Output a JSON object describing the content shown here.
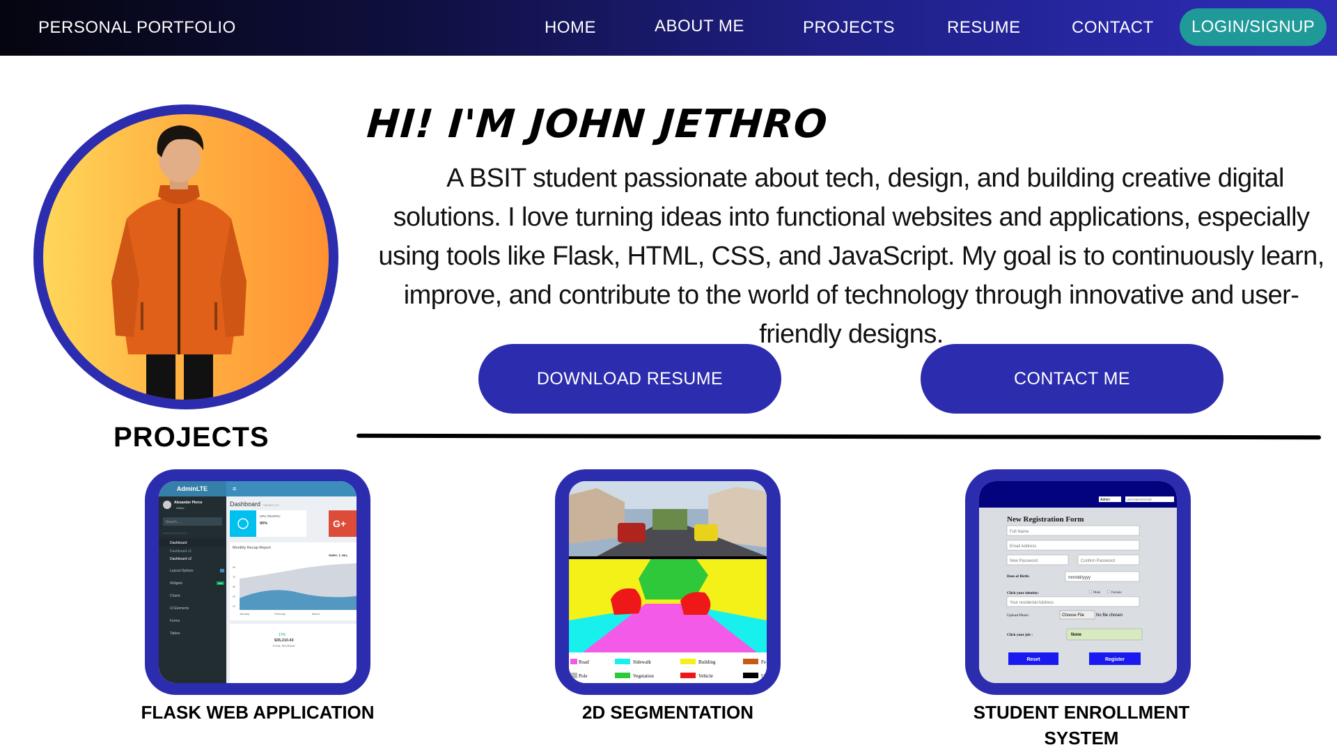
{
  "colors": {
    "accent": "#2c2cae",
    "login": "#1f9a99",
    "nav_start": "#05050f",
    "nav_end": "#2d2db8"
  },
  "navbar": {
    "brand": "PERSONAL PORTFOLIO",
    "links": [
      "HOME",
      "ABOUT ME",
      "PROJECTS",
      "RESUME",
      "CONTACT"
    ],
    "login": "LOGIN/SIGNUP"
  },
  "hero": {
    "title": "HI! I'M JOHN JETHRO",
    "description": "A BSIT student passionate about tech, design, and building creative digital solutions. I love turning ideas into functional websites and applications, especially using tools like Flask, HTML, CSS, and JavaScript. My goal is to continuously learn, improve, and contribute to the world of technology through innovative and user-friendly designs.",
    "buttons": {
      "resume": "DOWNLOAD RESUME",
      "contact": "CONTACT ME"
    }
  },
  "projects": {
    "heading": "PROJECTS",
    "items": [
      {
        "title": "FLASK WEB APPLICATION"
      },
      {
        "title": "2D SEGMENTATION"
      },
      {
        "title": "STUDENT ENROLLMENT SYSTEM"
      }
    ]
  },
  "thumb_admin": {
    "brand": "AdminLTE",
    "user": "Alexander Pierce",
    "status": "Online",
    "search": "Search...",
    "section": "MAIN NAVIGATION",
    "menu": [
      "Dashboard",
      "Dashboard v1",
      "Dashboard v2",
      "Layout Options",
      "Widgets",
      "Charts",
      "UI Elements",
      "Forms",
      "Tables"
    ],
    "page_title": "Dashboard",
    "version": "Version 2.0",
    "box_label": "CPU TRAFFIC",
    "box_value": "90%",
    "report_title": "Monthly Recap Report",
    "sales_label": "Sales: 1 Jan,",
    "months": [
      "January",
      "February",
      "March"
    ],
    "y_ticks": [
      "90",
      "80",
      "70",
      "60",
      "50",
      "40",
      "30",
      "20",
      "10"
    ],
    "stat_pct": "17%",
    "stat_value": "$35,210.43",
    "stat_label": "TOTAL REVENUE",
    "badge_new": "new"
  },
  "thumb_seg": {
    "legend": [
      "Road",
      "Sidewalk",
      "Building",
      "Fe",
      "Pole",
      "Vegetation",
      "Vehicle",
      "U"
    ],
    "legend_colors": [
      "#f45ae8",
      "#18f0ee",
      "#f4f118",
      "#c65a18",
      "#b8b8b8",
      "#2ec83a",
      "#ee1818",
      "#000000"
    ]
  },
  "thumb_form": {
    "role": "Admin",
    "username": "username/email",
    "title": "New Registration Form",
    "fields": [
      "Full Name",
      "Email Address",
      "New Password",
      "Confirm Password"
    ],
    "dob_label": "Date of Birth:",
    "dob_value": "mm/dd/yyyy",
    "identity_label": "Click your identity:",
    "gender": [
      "Male",
      "Female"
    ],
    "address": "Your residental Address",
    "photo_label": "Upload Photo:",
    "choose": "Choose File",
    "no_file": "No file chosen",
    "job_label": "Click your job :",
    "job_value": "None",
    "reset": "Reset",
    "register": "Register"
  }
}
